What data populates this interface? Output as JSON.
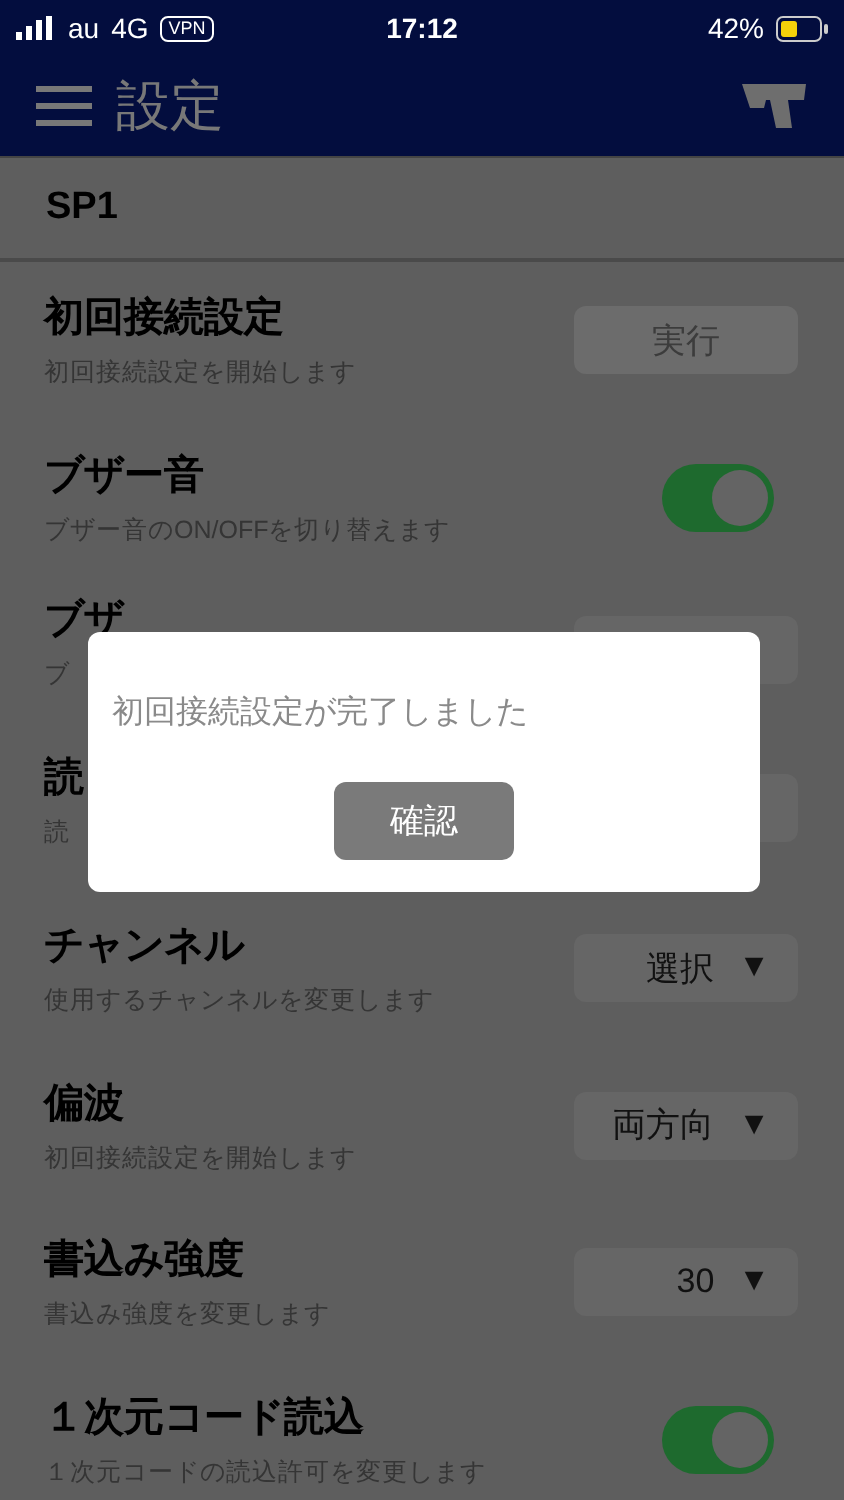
{
  "status_bar": {
    "carrier": "au",
    "network": "4G",
    "vpn": "VPN",
    "time": "17:12",
    "battery": "42%"
  },
  "header": {
    "title": "設定"
  },
  "section": {
    "title": "SP1"
  },
  "rows": [
    {
      "kind": "button",
      "title": "初回接続設定",
      "description": "初回接続設定を開始します",
      "button": "実行",
      "disabled": true
    },
    {
      "kind": "toggle",
      "title": "ブザー音",
      "description": "ブザー音のON/OFFを切り替えます",
      "on": true
    },
    {
      "kind": "select",
      "title": "ブザ",
      "description": "ブ"
    },
    {
      "kind": "select",
      "title": "読",
      "description": "読"
    },
    {
      "kind": "select",
      "title": "チャンネル",
      "description": "使用するチャンネルを変更します",
      "value": "選択",
      "arrow": "▼"
    },
    {
      "kind": "select",
      "title": "偏波",
      "description": "初回接続設定を開始します",
      "value": "両方向",
      "arrow": "▼"
    },
    {
      "kind": "select",
      "title": "書込み強度",
      "description": "書込み強度を変更します",
      "value": "30",
      "arrow": "▼"
    },
    {
      "kind": "toggle",
      "title": "１次元コード読込",
      "description": "１次元コードの読込許可を変更します",
      "on": true
    }
  ],
  "dialog": {
    "message": "初回接続設定が完了しました",
    "button": "確認"
  }
}
